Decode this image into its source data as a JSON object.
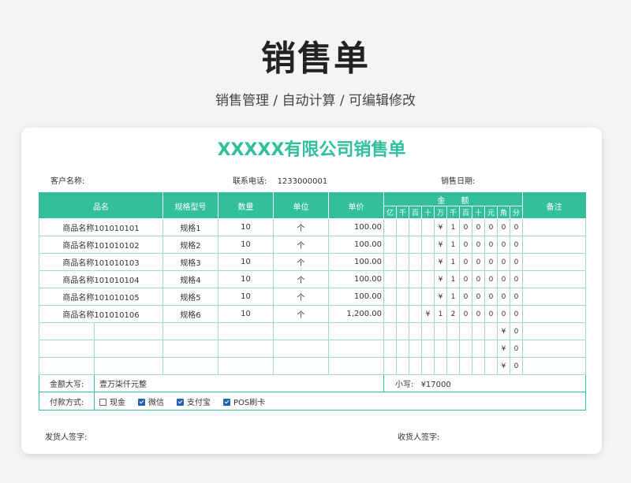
{
  "page": {
    "title": "销售单",
    "subtitle": "销售管理 / 自动计算 /  可编辑修改"
  },
  "form": {
    "title": "XXXXX有限公司销售单",
    "customer_label": "客户名称:",
    "phone_label": "联系电话:",
    "phone_value": "1233000001",
    "date_label": "销售日期:"
  },
  "table": {
    "headers": {
      "name": "品名",
      "spec": "规格型号",
      "qty": "数量",
      "unit": "单位",
      "price": "单价",
      "amount": "金　　额",
      "note": "备注"
    },
    "digit_headers": [
      "亿",
      "千",
      "百",
      "十",
      "万",
      "千",
      "百",
      "十",
      "元",
      "角",
      "分"
    ],
    "rows": [
      {
        "name": "商品名称101010101",
        "spec": "规格1",
        "qty": "10",
        "unit": "个",
        "price": "100.00",
        "digits": [
          "",
          "",
          "",
          "",
          "¥",
          "1",
          "0",
          "0",
          "0",
          "0",
          "0"
        ]
      },
      {
        "name": "商品名称101010102",
        "spec": "规格2",
        "qty": "10",
        "unit": "个",
        "price": "100.00",
        "digits": [
          "",
          "",
          "",
          "",
          "¥",
          "1",
          "0",
          "0",
          "0",
          "0",
          "0"
        ]
      },
      {
        "name": "商品名称101010103",
        "spec": "规格3",
        "qty": "10",
        "unit": "个",
        "price": "100.00",
        "digits": [
          "",
          "",
          "",
          "",
          "¥",
          "1",
          "0",
          "0",
          "0",
          "0",
          "0"
        ]
      },
      {
        "name": "商品名称101010104",
        "spec": "规格4",
        "qty": "10",
        "unit": "个",
        "price": "100.00",
        "digits": [
          "",
          "",
          "",
          "",
          "¥",
          "1",
          "0",
          "0",
          "0",
          "0",
          "0"
        ]
      },
      {
        "name": "商品名称101010105",
        "spec": "规格5",
        "qty": "10",
        "unit": "个",
        "price": "100.00",
        "digits": [
          "",
          "",
          "",
          "",
          "¥",
          "1",
          "0",
          "0",
          "0",
          "0",
          "0"
        ]
      },
      {
        "name": "商品名称101010106",
        "spec": "规格6",
        "qty": "10",
        "unit": "个",
        "price": "1,200.00",
        "digits": [
          "",
          "",
          "",
          "¥",
          "1",
          "2",
          "0",
          "0",
          "0",
          "0",
          "0"
        ]
      },
      {
        "name": "",
        "spec": "",
        "qty": "",
        "unit": "",
        "price": "",
        "digits": [
          "",
          "",
          "",
          "",
          "",
          "",
          "",
          "",
          "",
          "¥",
          "0"
        ]
      },
      {
        "name": "",
        "spec": "",
        "qty": "",
        "unit": "",
        "price": "",
        "digits": [
          "",
          "",
          "",
          "",
          "",
          "",
          "",
          "",
          "",
          "¥",
          "0"
        ]
      },
      {
        "name": "",
        "spec": "",
        "qty": "",
        "unit": "",
        "price": "",
        "digits": [
          "",
          "",
          "",
          "",
          "",
          "",
          "",
          "",
          "",
          "¥",
          "0"
        ]
      }
    ],
    "summary": {
      "uppercase_label": "金额大写:",
      "uppercase_value": "壹万柒仟元整",
      "lowercase_label": "小写:",
      "lowercase_value": "¥17000"
    },
    "payment": {
      "label": "付款方式:",
      "options": [
        {
          "label": "现金",
          "checked": false
        },
        {
          "label": "微信",
          "checked": true
        },
        {
          "label": "支付宝",
          "checked": true
        },
        {
          "label": "POS刷卡",
          "checked": true
        }
      ]
    }
  },
  "signatures": {
    "shipper_label": "发货人签字:",
    "receiver_label": "收货人签字:"
  },
  "colors": {
    "accent": "#34bf9c",
    "title_green": "#2fbf9b",
    "checkbox_blue": "#1f63b5"
  }
}
